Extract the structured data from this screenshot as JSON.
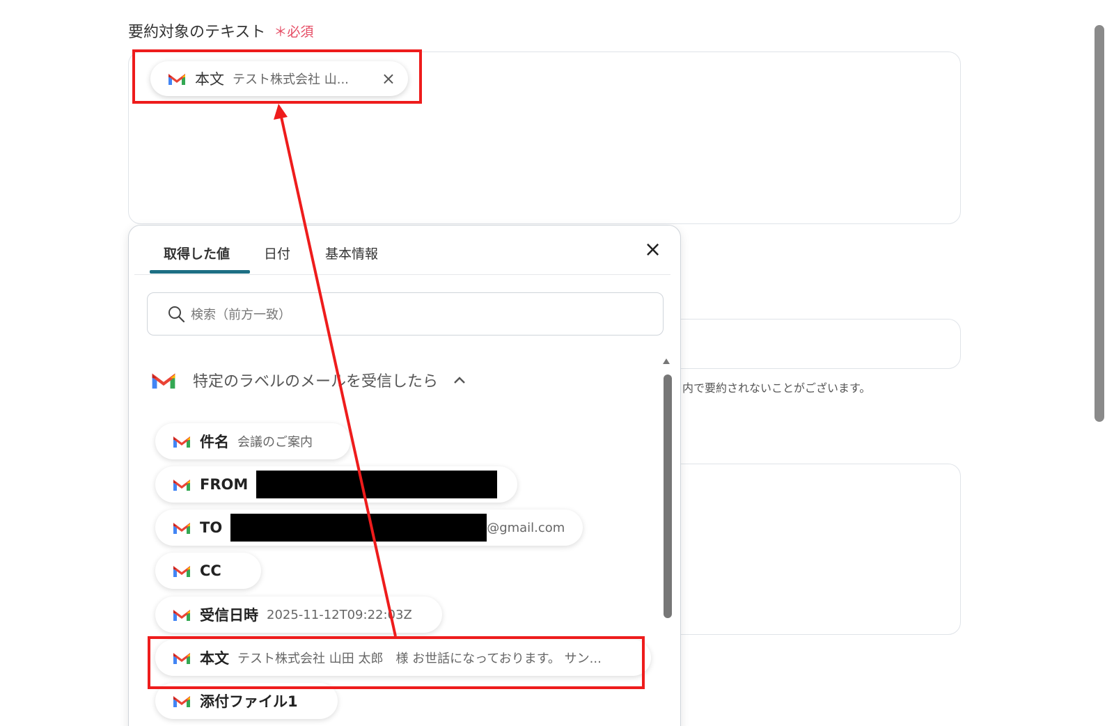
{
  "field": {
    "label": "要約対象のテキスト",
    "required": "＊必須"
  },
  "selected_token": {
    "name": "本文",
    "value": "テスト株式会社 山...",
    "remove_icon": "×"
  },
  "background": {
    "note": "内で要約されないことがございます。"
  },
  "popup": {
    "tabs": [
      {
        "label": "取得した値",
        "active": true
      },
      {
        "label": "日付",
        "active": false
      },
      {
        "label": "基本情報",
        "active": false
      }
    ],
    "close_icon": "×",
    "search_placeholder": "検索（前方一致）",
    "section_title": "特定のラベルのメールを受信したら",
    "section_chevron": "^",
    "items": [
      {
        "name": "件名",
        "value": "会議のご案内"
      },
      {
        "name": "FROM",
        "value": ""
      },
      {
        "name": "TO",
        "value": "@gmail.com"
      },
      {
        "name": "CC",
        "value": ""
      },
      {
        "name": "受信日時",
        "value": "2025-11-12T09:22:03Z"
      },
      {
        "name": "本文",
        "value": "テスト株式会社 山田 太郎　様 お世話になっております。 サン..."
      },
      {
        "name": "添付ファイル1",
        "value": ""
      }
    ]
  },
  "colors": {
    "accent_tab": "#1d6f84",
    "required": "#e54b63",
    "annotation_red": "#ee1c1c"
  }
}
